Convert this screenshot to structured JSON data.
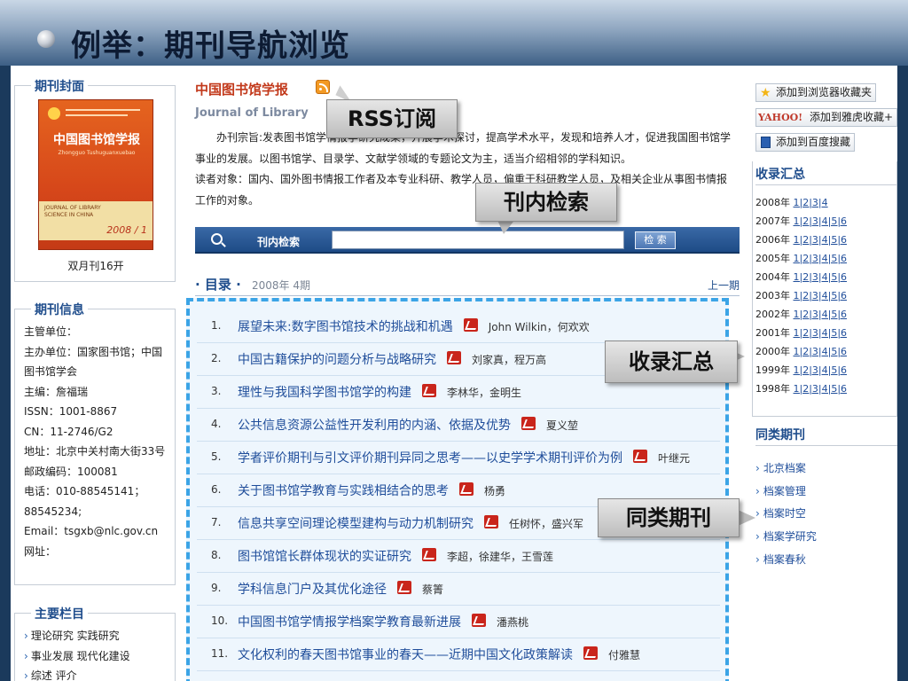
{
  "slide": {
    "title": "例举：期刊导航浏览"
  },
  "left": {
    "cover_title": "期刊封面",
    "cover": {
      "cn_title": "中国图书馆学报",
      "pinyin": "Zhongguo Tushuguanxuebao",
      "en_title": "JOURNAL OF LIBRARY SCIENCE IN CHINA",
      "year": "2008 / 1"
    },
    "frequency": "双月刊16开",
    "info_title": "期刊信息",
    "info": [
      "主管单位：",
      "主办单位：国家图书馆；中国图书馆学会",
      "主编：詹福瑞",
      "ISSN：1001-8867",
      "CN：11-2746/G2",
      "地址：北京中关村南大街33号",
      "邮政编码：100081",
      "电话：010-88545141；88545234;",
      "Email：tsgxb@nlc.gov.cn",
      "网址："
    ],
    "columns_title": "主要栏目",
    "columns": [
      "理论研究 实践研究",
      "事业发展 现代化建设",
      "综述 评介"
    ]
  },
  "main": {
    "journal_name": "中国图书馆学报",
    "journal_en": "Journal of Library",
    "intro": [
      "办刊宗旨:发表图书馆学情报学研究成果，开展学术探讨，提高学术水平，发现和培养人才，促进我国图书馆学事业的发展。以图书馆学、目录学、文献学领域的专题论文为主，适当介绍相邻的学科知识。",
      "读者对象：国内、国外图书情报工作者及本专业科研、教学人员，偏重于科研教学人员，及相关企业从事图书情报工作的对象。"
    ],
    "search_label": "刊内检索",
    "search_button": "检 索",
    "search_value": "",
    "toc_title": "· 目录 ·",
    "toc_issue": "2008年 4期",
    "toc_prev": "上一期",
    "articles": [
      {
        "num": "1.",
        "title": "展望未来:数字图书馆技术的挑战和机遇",
        "authors": "John Wilkin，何欢欢"
      },
      {
        "num": "2.",
        "title": "中国古籍保护的问题分析与战略研究",
        "authors": "刘家真，程万高"
      },
      {
        "num": "3.",
        "title": "理性与我国科学图书馆学的构建",
        "authors": "李林华，金明生"
      },
      {
        "num": "4.",
        "title": "公共信息资源公益性开发利用的内涵、依据及优势",
        "authors": "夏义堃"
      },
      {
        "num": "5.",
        "title": "学者评价期刊与引文评价期刊异同之思考——以史学学术期刊评价为例",
        "authors": "叶继元"
      },
      {
        "num": "6.",
        "title": "关于图书馆学教育与实践相结合的思考",
        "authors": "杨勇"
      },
      {
        "num": "7.",
        "title": "信息共享空间理论模型建构与动力机制研究",
        "authors": "任树怀，盛兴军"
      },
      {
        "num": "8.",
        "title": "图书馆馆长群体现状的实证研究",
        "authors": "李超，徐建华，王雪莲"
      },
      {
        "num": "9.",
        "title": "学科信息门户及其优化途径",
        "authors": "蔡箐"
      },
      {
        "num": "10.",
        "title": "中国图书馆学情报学档案学教育最新进展",
        "authors": "潘燕桃"
      },
      {
        "num": "11.",
        "title": "文化权利的春天图书馆事业的春天——近期中国文化政策解读",
        "authors": "付雅慧"
      }
    ]
  },
  "right": {
    "fav_browser": "添加到浏览器收藏夹",
    "fav_yahoo_logo": "YAHOO!",
    "fav_yahoo": "添加到雅虎收藏+",
    "fav_baidu": "添加到百度搜藏",
    "archive_title": "收录汇总",
    "archive": [
      {
        "year": "2008年",
        "issues": [
          "1",
          "2",
          "3",
          "4"
        ]
      },
      {
        "year": "2007年",
        "issues": [
          "1",
          "2",
          "3",
          "4",
          "5",
          "6"
        ]
      },
      {
        "year": "2006年",
        "issues": [
          "1",
          "2",
          "3",
          "4",
          "5",
          "6"
        ]
      },
      {
        "year": "2005年",
        "issues": [
          "1",
          "2",
          "3",
          "4",
          "5",
          "6"
        ]
      },
      {
        "year": "2004年",
        "issues": [
          "1",
          "2",
          "3",
          "4",
          "5",
          "6"
        ]
      },
      {
        "year": "2003年",
        "issues": [
          "1",
          "2",
          "3",
          "4",
          "5",
          "6"
        ]
      },
      {
        "year": "2002年",
        "issues": [
          "1",
          "2",
          "3",
          "4",
          "5",
          "6"
        ]
      },
      {
        "year": "2001年",
        "issues": [
          "1",
          "2",
          "3",
          "4",
          "5",
          "6"
        ]
      },
      {
        "year": "2000年",
        "issues": [
          "1",
          "2",
          "3",
          "4",
          "5",
          "6"
        ]
      },
      {
        "year": "1999年",
        "issues": [
          "1",
          "2",
          "3",
          "4",
          "5",
          "6"
        ]
      },
      {
        "year": "1998年",
        "issues": [
          "1",
          "2",
          "3",
          "4",
          "5",
          "6"
        ]
      }
    ],
    "similar_title": "同类期刊",
    "similar": [
      "北京档案",
      "档案管理",
      "档案时空",
      "档案学研究",
      "档案春秋"
    ]
  },
  "callouts": {
    "rss": "RSS订阅",
    "search": "刊内检索",
    "archive": "收录汇总",
    "similar": "同类期刊"
  }
}
